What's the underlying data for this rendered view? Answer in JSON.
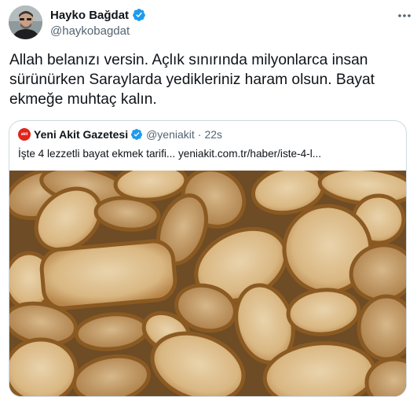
{
  "tweet": {
    "author_name": "Hayko Bağdat",
    "author_handle": "@haykobagdat",
    "text": "Allah belanızı versin. Açlık sınırında milyonlarca insan sürünürken Saraylarda yedikleriniz haram olsun. Bayat ekmeğe muhtaç kalın."
  },
  "quoted": {
    "logo_text": "akit",
    "author_name": "Yeni Akit Gazetesi",
    "author_handle": "@yeniakit",
    "separator": "·",
    "time": "22s",
    "text": "İşte 4 lezzetli bayat ekmek tarifi... yeniakit.com.tr/haber/iste-4-l..."
  },
  "icons": {
    "verified": "verified-badge-icon",
    "more": "more-options-icon",
    "avatar": "profile-photo",
    "media": "bread-slices-photo"
  },
  "colors": {
    "verified": "#1d9bf0",
    "secondary_text": "#536471",
    "border": "#cfd9de",
    "akit_red": "#e0241b"
  }
}
